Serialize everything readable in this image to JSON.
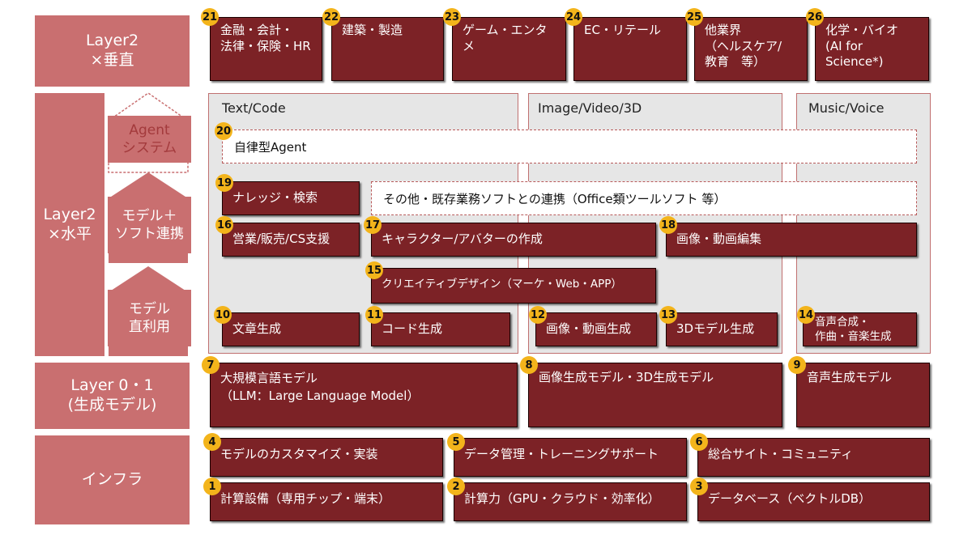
{
  "layers": {
    "vertical": "Layer2\n×垂直",
    "horizontal": "Layer2\n×水平",
    "model": "Layer 0・1\n(生成モデル)",
    "infra": "インフラ"
  },
  "sublayers": {
    "agent": "Agent\nシステム",
    "model_soft": "モデル＋\nソフト連携",
    "model_direct": "モデル\n直利用"
  },
  "columns": {
    "text": "Text/Code",
    "image": "Image/Video/3D",
    "music": "Music/Voice"
  },
  "vertical_boxes": [
    {
      "num": "21",
      "label": "金融・会計・\n法律・保険・HR"
    },
    {
      "num": "22",
      "label": "建築・製造"
    },
    {
      "num": "23",
      "label": "ゲーム・エンタメ"
    },
    {
      "num": "24",
      "label": "EC・リテール"
    },
    {
      "num": "25",
      "label": "他業界\n（ヘルスケア/\n教育　等）"
    },
    {
      "num": "26",
      "label": "化学・バイオ\n(AI for\nScience*)"
    }
  ],
  "agent": {
    "num": "20",
    "label": "自律型Agent"
  },
  "knowledge": {
    "num": "19",
    "label": "ナレッジ・検索"
  },
  "other_soft": "その他・既存業務ソフトとの連携（Office類ツールソフト 等）",
  "app_boxes": {
    "sales": {
      "num": "16",
      "label": "営業/販売/CS支援"
    },
    "character": {
      "num": "17",
      "label": "キャラクター/アバターの作成"
    },
    "image_edit": {
      "num": "18",
      "label": "画像・動画編集"
    },
    "creative": {
      "num": "15",
      "label": "クリエイティブデザイン（マーケ・Web・APP）"
    },
    "text_gen": {
      "num": "10",
      "label": "文章生成"
    },
    "code_gen": {
      "num": "11",
      "label": "コード生成"
    },
    "image_gen": {
      "num": "12",
      "label": "画像・動画生成"
    },
    "model3d_gen": {
      "num": "13",
      "label": "3Dモデル生成"
    },
    "voice_gen": {
      "num": "14",
      "label": "音声合成・\n作曲・音楽生成"
    }
  },
  "model_boxes": [
    {
      "num": "7",
      "label": "大規模言語モデル\n（LLM：Large Language Model）"
    },
    {
      "num": "8",
      "label": "画像生成モデル・3D生成モデル"
    },
    {
      "num": "9",
      "label": "音声生成モデル"
    }
  ],
  "infra_boxes": [
    {
      "num": "4",
      "label": "モデルのカスタマイズ・実装"
    },
    {
      "num": "5",
      "label": "データ管理・トレーニングサポート"
    },
    {
      "num": "6",
      "label": "総合サイト・コミュニティ"
    },
    {
      "num": "1",
      "label": "計算設備（専用チップ・端末）"
    },
    {
      "num": "2",
      "label": "計算力（GPU・クラウド・効率化）"
    },
    {
      "num": "3",
      "label": "データベース（ベクトルDB）"
    }
  ],
  "colors": {
    "layer": "#c96f70",
    "box": "#7c2226",
    "badge": "#f3b41b",
    "column": "#e6e6e6"
  }
}
